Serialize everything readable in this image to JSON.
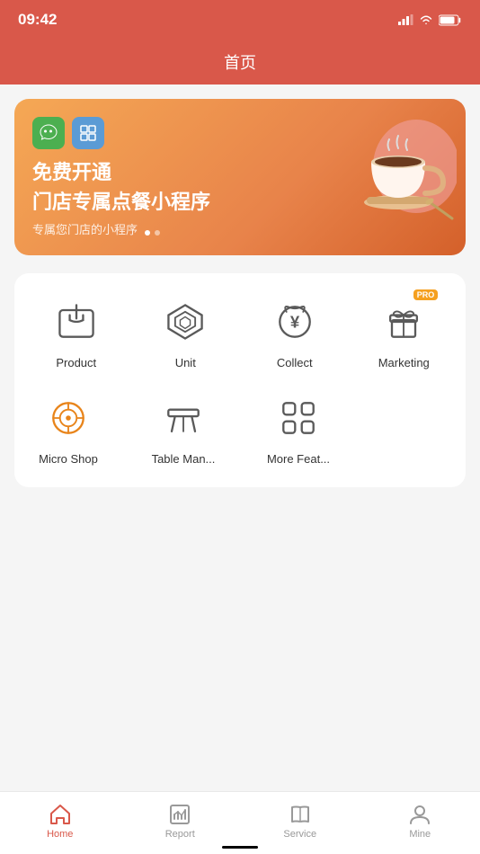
{
  "statusBar": {
    "time": "09:42"
  },
  "header": {
    "title": "首页"
  },
  "banner": {
    "icon1": "⊕",
    "icon2": "◈",
    "title_line1": "免费开通",
    "title_line2": "门店专属点餐小程序",
    "subtitle": "专属您门店的小程序",
    "dots": [
      true,
      false
    ]
  },
  "menuRows": [
    [
      {
        "id": "product",
        "label": "Product",
        "icon": "product"
      },
      {
        "id": "unit",
        "label": "Unit",
        "icon": "unit"
      },
      {
        "id": "collect",
        "label": "Collect",
        "icon": "collect"
      },
      {
        "id": "marketing",
        "label": "Marketing",
        "icon": "marketing",
        "pro": true
      }
    ],
    [
      {
        "id": "micro-shop",
        "label": "Micro Shop",
        "icon": "microshop"
      },
      {
        "id": "table-man",
        "label": "Table Man...",
        "icon": "table"
      },
      {
        "id": "more-feat",
        "label": "More Feat...",
        "icon": "more"
      }
    ]
  ],
  "bottomNav": [
    {
      "id": "home",
      "label": "Home",
      "active": true
    },
    {
      "id": "report",
      "label": "Report",
      "active": false
    },
    {
      "id": "service",
      "label": "Service",
      "active": false
    },
    {
      "id": "mine",
      "label": "Mine",
      "active": false
    }
  ]
}
